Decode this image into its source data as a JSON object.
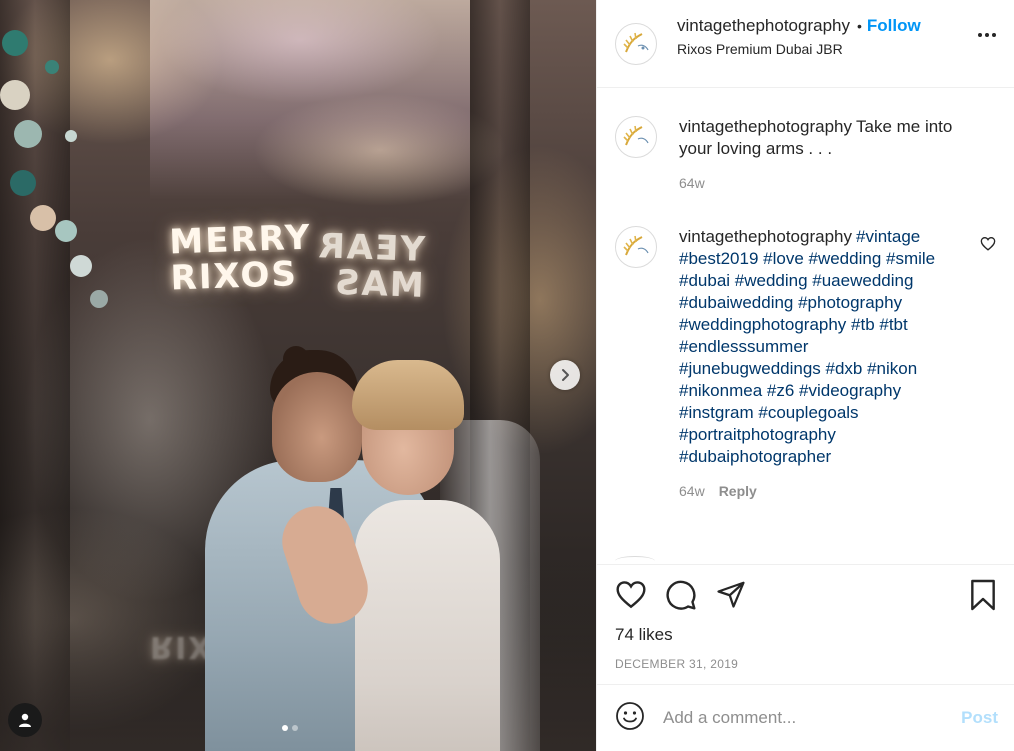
{
  "post": {
    "username": "vintagethephotography",
    "follow_label": "Follow",
    "bullet": "•",
    "location": "Rixos Premium Dubai JBR",
    "photo": {
      "sign_left_line1": "MERRY",
      "sign_left_line2": "RIXOS",
      "sign_right_line1": "YEAR",
      "sign_right_line2": "MAS",
      "reflection_text": "RIXOS",
      "carousel_total": 2,
      "carousel_active": 1
    }
  },
  "comments": [
    {
      "username": "vintagethephotography",
      "text": "Take me into your loving arms . . .",
      "time": "64w"
    },
    {
      "username": "vintagethephotography",
      "hashtags": "#vintage #best2019 #love #wedding #smile #dubai #wedding #uaewedding #dubaiwedding #photography #weddingphotography #tb #tbt #endlesssummer #junebugweddings #dxb #nikon #nikonmea #z6 #videography #instgram #couplegoals #portraitphotography #dubaiphotographer",
      "time": "64w",
      "reply_label": "Reply"
    }
  ],
  "stats": {
    "likes": "74 likes",
    "date": "DECEMBER 31, 2019"
  },
  "composer": {
    "placeholder": "Add a comment...",
    "post_label": "Post"
  },
  "colors": {
    "accent_blue": "#0095f6",
    "hashtag_blue": "#00376b",
    "post_disabled": "#b2dffc",
    "secondary_text": "#8e8e8e",
    "divider": "#efefef"
  },
  "icons": {
    "more": "ellipsis-icon",
    "heart": "heart-icon",
    "comment": "comment-bubble-icon",
    "share": "paper-plane-icon",
    "save": "bookmark-icon",
    "emoji": "smiley-icon",
    "tag": "user-tag-icon",
    "next": "chevron-right-icon"
  }
}
